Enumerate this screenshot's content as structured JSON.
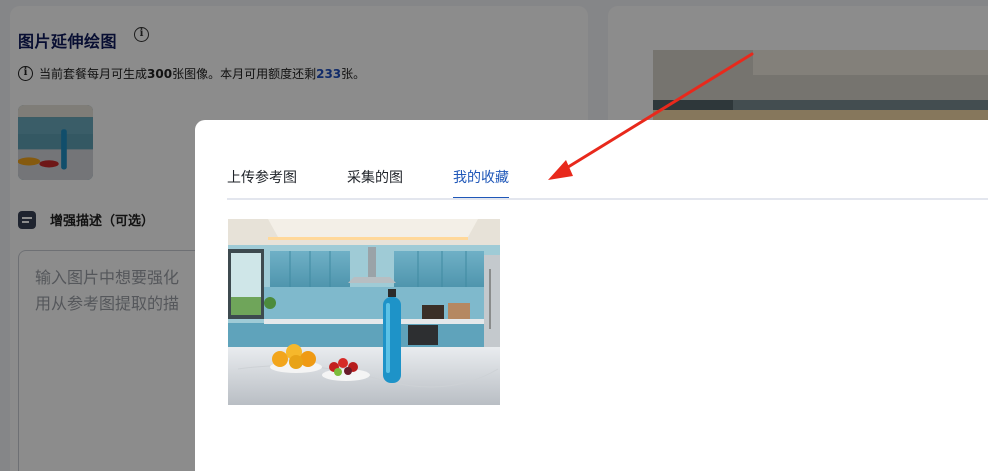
{
  "left_panel": {
    "title": "图片延伸绘图",
    "quota": {
      "prefix": "当前套餐每月可生成",
      "monthly_count": "300",
      "middle": "张图像。本月可用额度还剩",
      "remaining": "233",
      "suffix": "张。"
    },
    "enhance_label": "增强描述（可选）",
    "textarea_placeholder_line1": "输入图片中想要强化",
    "textarea_placeholder_line2": "用从参考图提取的描"
  },
  "modal": {
    "tabs": [
      {
        "label": "上传参考图"
      },
      {
        "label": "采集的图"
      },
      {
        "label": "我的收藏"
      }
    ],
    "active_tab_index": 2
  },
  "colors": {
    "accent": "#1f57b8",
    "arrow": "#e8291c",
    "title": "#0f1b5c"
  },
  "icons": [
    "info-icon",
    "document-icon",
    "arrow-annotation"
  ]
}
